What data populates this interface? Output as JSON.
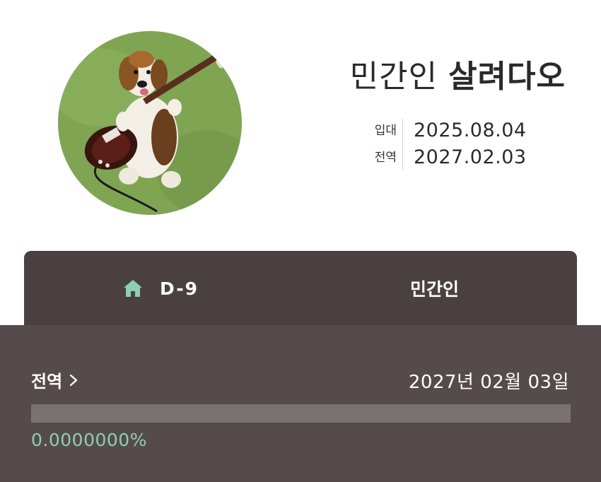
{
  "profile": {
    "avatar_alt": "beagle-with-guitar",
    "name_light": "민간인",
    "name_bold": "살려다오"
  },
  "dates": {
    "enlist_label": "입대",
    "enlist_value": "2025.08.04",
    "discharge_label": "전역",
    "discharge_value": "2027.02.03"
  },
  "tabs": {
    "dday_icon": "home-icon",
    "dday_label": "D-9",
    "civilian_label": "민간인"
  },
  "panel": {
    "discharge_link_label": "전역",
    "discharge_date_text": "2027년 02월 03일",
    "progress_fraction": 0,
    "progress_text": "0.0000000%"
  },
  "colors": {
    "tab_bg": "#4b4041",
    "panel_bg": "#564b4c",
    "accent_mint": "#8ccfb6",
    "track": "#7a7172"
  }
}
